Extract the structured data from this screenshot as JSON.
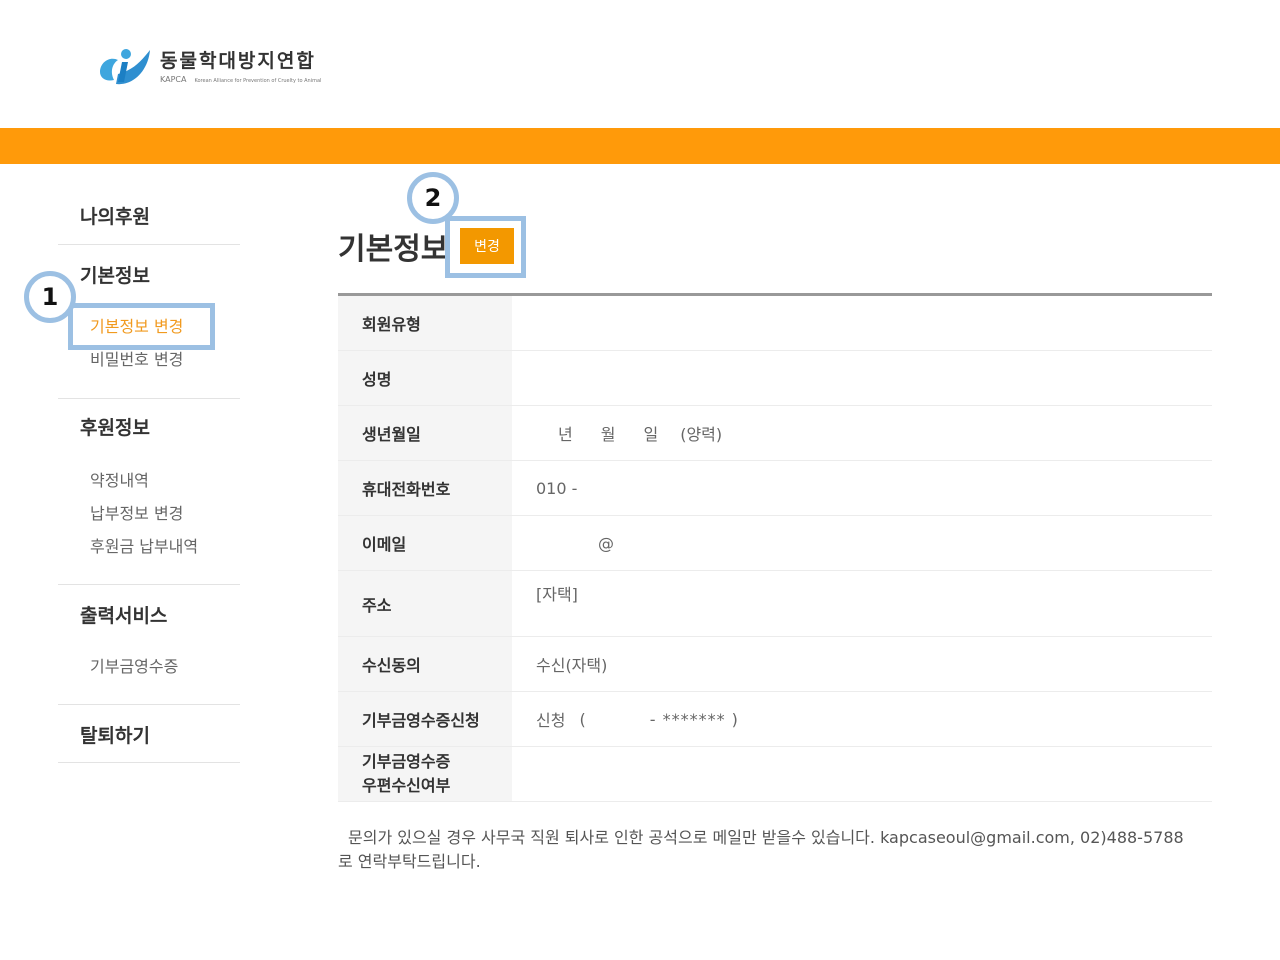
{
  "logo": {
    "title": "동물학대방지연합",
    "abbr": "KAPCA",
    "tagline": "Korean Alliance for Prevention of Cruelty to Animal"
  },
  "colors": {
    "brand_orange": "#ff9a0a",
    "button_orange": "#f39800",
    "active_link": "#f19a1f",
    "annotation_blue": "#9cc0e3"
  },
  "sidebar": {
    "my_support": "나의후원",
    "basic_info": {
      "heading": "기본정보",
      "items": [
        "기본정보 변경",
        "비밀번호 변경"
      ],
      "active_index": 0
    },
    "support_info": {
      "heading": "후원정보",
      "items": [
        "약정내역",
        "납부정보 변경",
        "후원금 납부내역"
      ]
    },
    "print_service": {
      "heading": "출력서비스",
      "items": [
        "기부금영수증"
      ]
    },
    "withdraw": "탈퇴하기"
  },
  "annotations": {
    "badge_1": "1",
    "badge_2": "2"
  },
  "main": {
    "title": "기본정보",
    "change_button": "변경",
    "rows": {
      "member_type": {
        "label": "회원유형",
        "value": ""
      },
      "name": {
        "label": "성명",
        "value": ""
      },
      "birth": {
        "label": "생년월일",
        "year_unit": "년",
        "month_unit": "월",
        "day_unit": "일",
        "calendar": "(양력)"
      },
      "mobile": {
        "label": "휴대전화번호",
        "value": "010 -"
      },
      "email": {
        "label": "이메일",
        "value": "@"
      },
      "address": {
        "label": "주소",
        "value": "[자택]"
      },
      "consent": {
        "label": "수신동의",
        "value": "수신(자택)"
      },
      "receipt_request": {
        "label": "기부금영수증신청",
        "status": "신청",
        "open": "(",
        "masked": "- ******* )"
      },
      "receipt_mail": {
        "label_line1": "기부금영수증",
        "label_line2": "우편수신여부",
        "value": ""
      }
    },
    "notice": "문의가 있으실 경우 사무국 직원 퇴사로 인한 공석으로 메일만 받을수 있습니다. kapcaseoul@gmail.com, 02)488-5788로 연락부탁드립니다."
  }
}
